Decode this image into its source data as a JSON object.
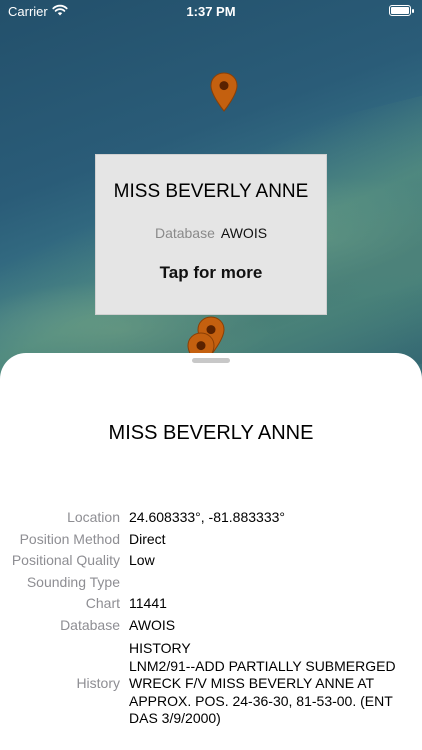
{
  "status_bar": {
    "carrier": "Carrier",
    "time": "1:37 PM"
  },
  "callout": {
    "title": "MISS BEVERLY ANNE",
    "database_label": "Database",
    "database_value": "AWOIS",
    "more_label": "Tap for more"
  },
  "sheet": {
    "title": "MISS BEVERLY ANNE",
    "details": [
      {
        "label": "Location",
        "value": "24.608333°, -81.883333°"
      },
      {
        "label": "Position Method",
        "value": "Direct"
      },
      {
        "label": "Positional Quality",
        "value": "Low"
      },
      {
        "label": "Sounding Type",
        "value": ""
      },
      {
        "label": "Chart",
        "value": "11441"
      },
      {
        "label": "Database",
        "value": "AWOIS"
      }
    ],
    "history": {
      "label": "History",
      "value": "  HISTORY\n LNM2/91--ADD PARTIALLY SUBMERGED WRECK F/V MISS BEVERLY ANNE AT APPROX. POS. 24-36-30, 81-53-00. (ENT DAS 3/9/2000)"
    }
  },
  "colors": {
    "pin": "#c4600f",
    "pin_dot": "#5a2200",
    "callout_bg": "#e5e5e5"
  },
  "icons": [
    "wifi-icon",
    "battery-icon",
    "map-pin-icon"
  ]
}
